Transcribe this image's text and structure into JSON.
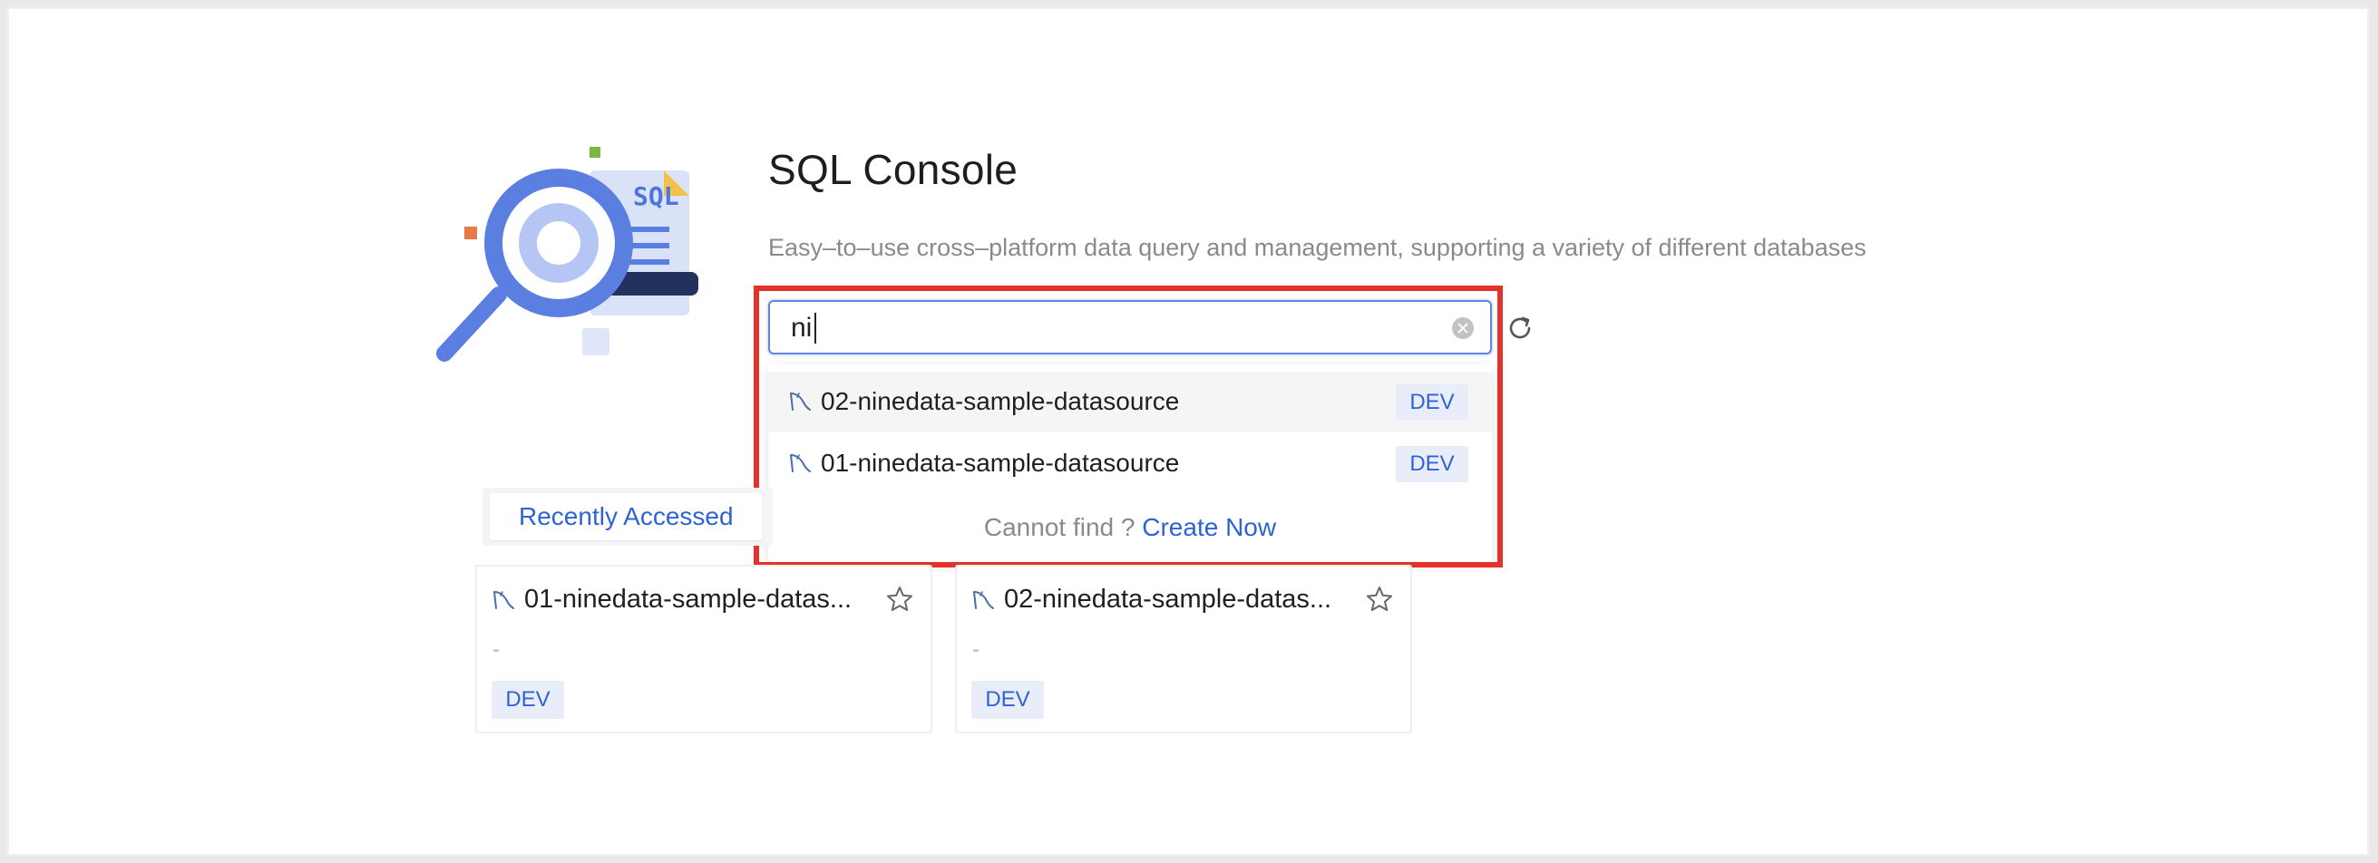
{
  "header": {
    "title": "SQL Console",
    "subtitle": "Easy–to–use cross–platform data query and management, supporting a variety of different databases",
    "illustration_label": "SQL"
  },
  "search": {
    "value": "ni"
  },
  "dropdown": {
    "items": [
      {
        "name": "02-ninedata-sample-datasource",
        "tag": "DEV"
      },
      {
        "name": "01-ninedata-sample-datasource",
        "tag": "DEV"
      }
    ],
    "footer_text": "Cannot find ?",
    "footer_link": "Create Now"
  },
  "tabs": {
    "active": "Recently Accessed"
  },
  "cards": [
    {
      "name": "01-ninedata-sample-datas...",
      "description": "-",
      "tag": "DEV"
    },
    {
      "name": "02-ninedata-sample-datas...",
      "description": "-",
      "tag": "DEV"
    }
  ],
  "colors": {
    "accent": "#2e63d6",
    "highlight_border": "#e4322b",
    "tag_background": "#e8edf9"
  },
  "icons": [
    "magnifier-sql-illustration",
    "clear-icon",
    "refresh-icon",
    "mysql-icon",
    "star-icon"
  ]
}
